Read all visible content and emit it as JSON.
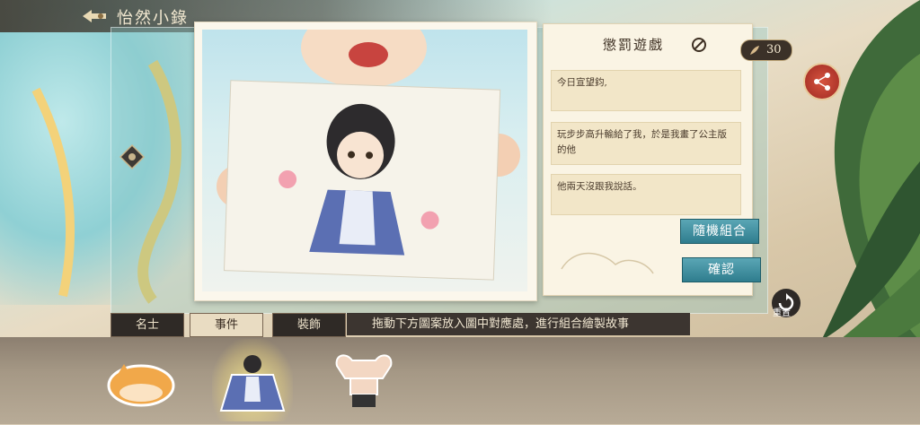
{
  "header": {
    "title": "怡然小錄"
  },
  "note": {
    "title": "懲罰遊戲",
    "lines": [
      "今日宣望鈞,",
      "玩步步高升輸給了我，於是我畫了公主版的他",
      "他兩天沒跟我說話。"
    ]
  },
  "counter": {
    "value": "30"
  },
  "buttons": {
    "random": "隨機組合",
    "confirm": "確認",
    "reset": "重置"
  },
  "tabs": [
    {
      "label": "名士",
      "active": false
    },
    {
      "label": "事件",
      "active": true
    },
    {
      "label": "裝飾",
      "active": false
    }
  ],
  "hint": "拖動下方圖案放入圖中對應處，進行組合繪製故事",
  "tray_items": [
    {
      "name": "sleeping-cat-sticker",
      "selected": false
    },
    {
      "name": "princess-figure-sticker",
      "selected": true
    },
    {
      "name": "muscle-figure-sticker",
      "selected": false
    }
  ],
  "colors": {
    "accent": "#2f7d8e",
    "share": "#b83a2c",
    "panel": "#faf4e4"
  }
}
